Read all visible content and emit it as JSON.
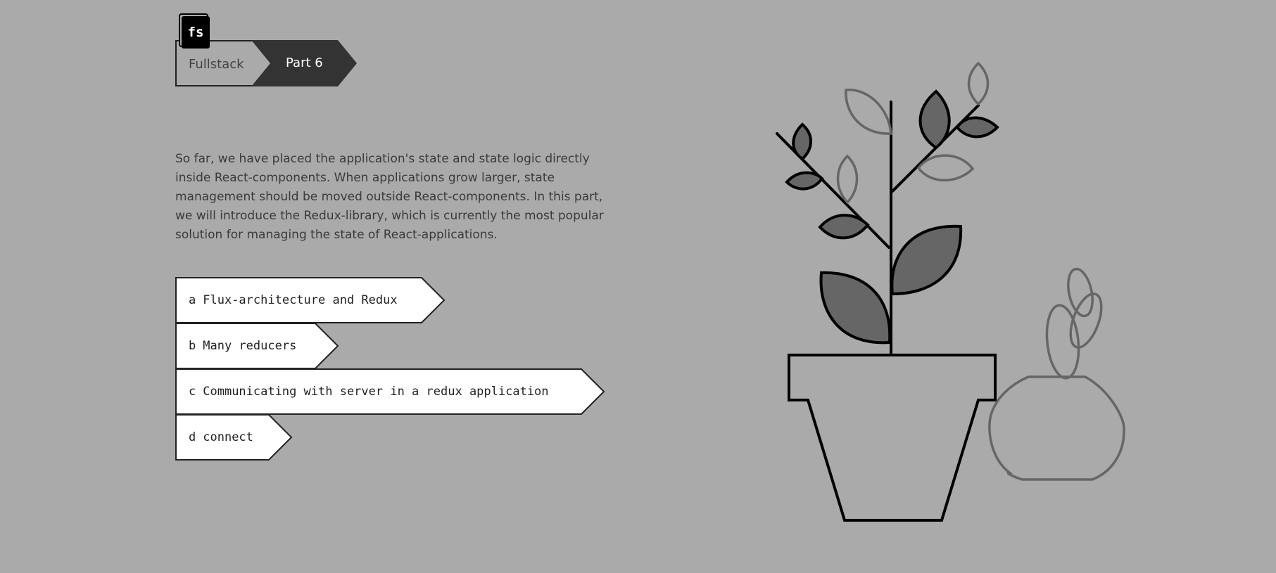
{
  "logo": {
    "text": "fs"
  },
  "breadcrumb": {
    "course": "Fullstack",
    "part": "Part 6"
  },
  "intro": "So far, we have placed the application's state and state logic directly inside React-components. When applications grow larger, state management should be moved outside React-components. In this part, we will introduce the Redux-library, which is currently the most popular solution for managing the state of React-applications.",
  "toc": [
    {
      "letter": "a",
      "title": "Flux-architecture and Redux"
    },
    {
      "letter": "b",
      "title": "Many reducers"
    },
    {
      "letter": "c",
      "title": "Communicating with server in a redux application"
    },
    {
      "letter": "d",
      "title": "connect"
    }
  ],
  "colors": {
    "background": "#aaaaaa",
    "crumb_active": "#333333",
    "leaf_fill": "#666666",
    "outline": "#000000",
    "faded_outline": "#666666"
  }
}
